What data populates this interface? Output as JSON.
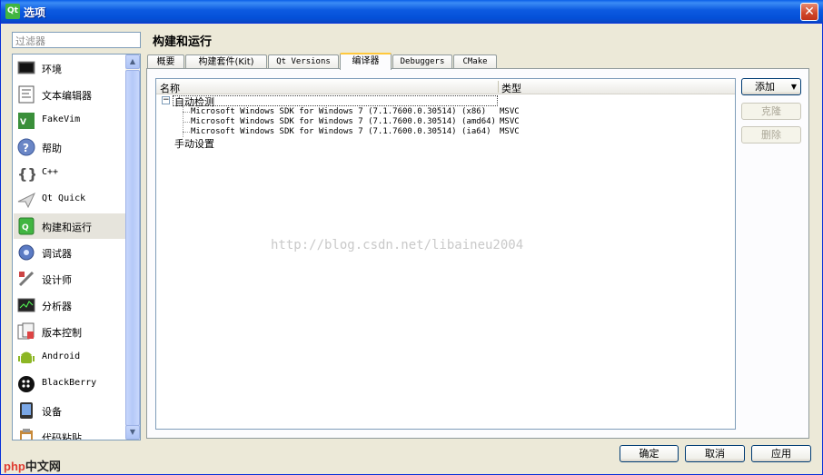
{
  "window": {
    "title": "选项",
    "app_icon_text": "Qt",
    "close_symbol": "✕"
  },
  "filter": {
    "placeholder": "过滤器"
  },
  "sidebar": {
    "items": [
      {
        "label": "环境",
        "icon": "monitor-icon"
      },
      {
        "label": "文本编辑器",
        "icon": "text-editor-icon"
      },
      {
        "label": "FakeVim",
        "icon": "fakevim-icon"
      },
      {
        "label": "帮助",
        "icon": "help-icon"
      },
      {
        "label": "C++",
        "icon": "cpp-braces-icon"
      },
      {
        "label": "Qt Quick",
        "icon": "paper-plane-icon"
      },
      {
        "label": "构建和运行",
        "icon": "build-run-icon"
      },
      {
        "label": "调试器",
        "icon": "debugger-icon"
      },
      {
        "label": "设计师",
        "icon": "designer-icon"
      },
      {
        "label": "分析器",
        "icon": "analyzer-icon"
      },
      {
        "label": "版本控制",
        "icon": "version-control-icon"
      },
      {
        "label": "Android",
        "icon": "android-icon"
      },
      {
        "label": "BlackBerry",
        "icon": "blackberry-icon"
      },
      {
        "label": "设备",
        "icon": "device-icon"
      },
      {
        "label": "代码粘贴",
        "icon": "code-paste-icon"
      }
    ],
    "selected_index": 6
  },
  "page": {
    "title": "构建和运行"
  },
  "tabs": [
    {
      "label": "概要"
    },
    {
      "label": "构建套件(Kit)"
    },
    {
      "label": "Qt Versions"
    },
    {
      "label": "编译器"
    },
    {
      "label": "Debuggers"
    },
    {
      "label": "CMake"
    }
  ],
  "active_tab": 3,
  "tree": {
    "columns": [
      "名称",
      "类型"
    ],
    "group_auto": "自动检测",
    "group_manual": "手动设置",
    "rows": [
      {
        "name": "Microsoft Windows SDK for Windows 7 (7.1.7600.0.30514) (x86)",
        "type": "MSVC"
      },
      {
        "name": "Microsoft Windows SDK for Windows 7 (7.1.7600.0.30514) (amd64)",
        "type": "MSVC"
      },
      {
        "name": "Microsoft Windows SDK for Windows 7 (7.1.7600.0.30514) (ia64)",
        "type": "MSVC"
      }
    ]
  },
  "side_buttons": {
    "add": "添加",
    "add_arrow": "▼",
    "clone": "克隆",
    "remove": "删除"
  },
  "watermark": "http://blog.csdn.net/libaineu2004",
  "footer": {
    "ok": "确定",
    "cancel": "取消",
    "apply": "应用"
  },
  "branding": {
    "php": "php",
    "site": "中文网"
  }
}
